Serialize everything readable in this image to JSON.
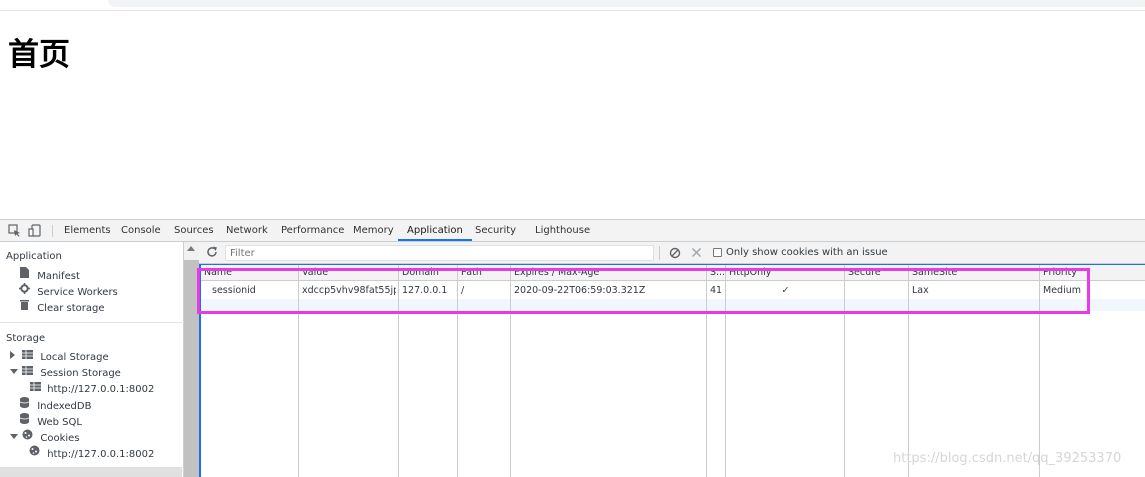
{
  "page": {
    "heading": "首页"
  },
  "devtools": {
    "tabs": [
      "Elements",
      "Console",
      "Sources",
      "Network",
      "Performance",
      "Memory",
      "Application",
      "Security",
      "Lighthouse"
    ],
    "active_tab": "Application"
  },
  "sidebar": {
    "application_header": "Application",
    "application_items": [
      "Manifest",
      "Service Workers",
      "Clear storage"
    ],
    "storage_header": "Storage",
    "local_storage": "Local Storage",
    "session_storage": "Session Storage",
    "session_storage_origin": "http://127.0.0.1:8002",
    "indexeddb": "IndexedDB",
    "websql": "Web SQL",
    "cookies": "Cookies",
    "cookies_origin": "http://127.0.0.1:8002"
  },
  "cookies_toolbar": {
    "filter_placeholder": "Filter",
    "only_issues_label": "Only show cookies with an issue"
  },
  "cookies_table": {
    "headers": [
      "Name",
      "Value",
      "Domain",
      "Path",
      "Expires / Max-Age",
      "S...",
      "HttpOnly",
      "Secure",
      "SameSite",
      "Priority"
    ],
    "rows": [
      [
        "sessionid",
        "xdccp5vhv98fat55jp...",
        "127.0.0.1",
        "/",
        "2020-09-22T06:59:03.321Z",
        "41",
        "✓",
        "",
        "Lax",
        "Medium"
      ]
    ]
  },
  "watermark": "https://blog.csdn.net/qq_39253370",
  "colors": {
    "accent": "#1a73e8",
    "highlight": "#e83ae8"
  }
}
